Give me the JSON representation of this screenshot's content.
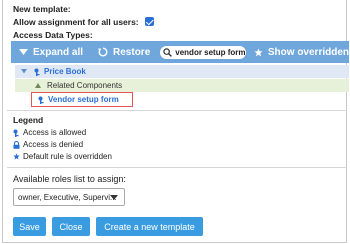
{
  "template_heading": "New template:",
  "allow_label": "Allow assignment for all users:",
  "allow_checked": true,
  "access_types_label": "Access Data Types:",
  "toolbar": {
    "expand_all": "Expand all",
    "restore": "Restore",
    "search_value": "vendor setup form",
    "show_overridden": "Show overridden"
  },
  "tree": {
    "root": "Price Book",
    "child": "Related Components",
    "leaf": "Vendor setup form"
  },
  "legend": {
    "title": "Legend",
    "allowed": "Access is allowed",
    "denied": "Access is denied",
    "overridden": "Default rule is overridden"
  },
  "roles": {
    "label": "Available roles list to assign:",
    "selected": "owner, Executive, Supervi..."
  },
  "buttons": {
    "save": "Save",
    "close": "Close",
    "create": "Create a new template"
  },
  "colors": {
    "toolbar": "#6fa7dd",
    "accent": "#2a6fd6",
    "button": "#3a9ce0",
    "highlight": "#e05555",
    "tree_selected": "#dfe8f4",
    "tree_child": "#e7f0d8"
  }
}
